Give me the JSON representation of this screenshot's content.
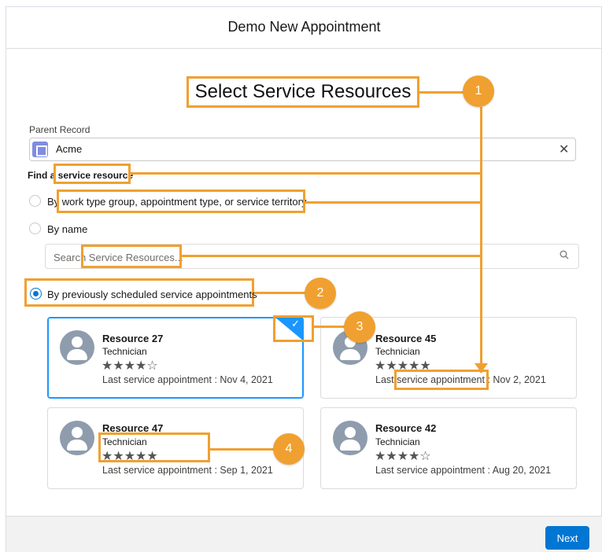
{
  "modal": {
    "title": "Demo New Appointment",
    "next_label": "Next"
  },
  "heading": "Select Service Resources",
  "parent_record": {
    "label": "Parent Record",
    "value": "Acme",
    "clear_icon": "close-icon"
  },
  "find": {
    "label": "Find a service resource",
    "option_work_type": "By work type group, appointment type, or service territory",
    "option_name": "By name",
    "search_placeholder": "Search Service Resources...",
    "option_previous": "By previously scheduled service appointments"
  },
  "resources": [
    {
      "name": "Resource 27",
      "role": "Technician",
      "stars": "★★★★☆",
      "rating": 4,
      "last": "Last service appointment : Nov 4, 2021",
      "selected": true
    },
    {
      "name": "Resource 45",
      "role": "Technician",
      "stars": "★★★★★",
      "rating": 5,
      "last": "Last service appointment : Nov 2, 2021",
      "selected": false
    },
    {
      "name": "Resource 47",
      "role": "Technician",
      "stars": "★★★★★",
      "rating": 5,
      "last": "Last service appointment : Sep 1, 2021",
      "selected": false
    },
    {
      "name": "Resource 42",
      "role": "Technician",
      "stars": "★★★★☆",
      "rating": 4,
      "last": "Last service appointment : Aug 20, 2021",
      "selected": false
    }
  ],
  "callouts": {
    "b1": "1",
    "b2": "2",
    "b3": "3",
    "b4": "4"
  },
  "colors": {
    "callout": "#f0a030",
    "brand": "#0176d3",
    "selected_border": "#1b96ff"
  }
}
